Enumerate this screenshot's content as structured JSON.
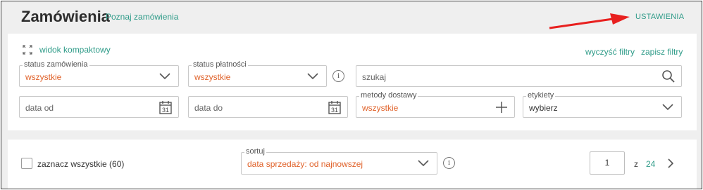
{
  "header": {
    "title": "Zamówienia",
    "learn_link": "Poznaj zamówienia",
    "settings_link": "USTAWIENIA"
  },
  "filters": {
    "compact_view": "widok kompaktowy",
    "clear_filters": "wyczyść filtry",
    "save_filters": "zapisz filtry",
    "order_status": {
      "label": "status zamówienia",
      "value": "wszystkie"
    },
    "payment_status": {
      "label": "status płatności",
      "value": "wszystkie"
    },
    "search": {
      "placeholder": "szukaj"
    },
    "date_from": {
      "placeholder": "data od"
    },
    "date_to": {
      "placeholder": "data do"
    },
    "delivery_methods": {
      "label": "metody dostawy",
      "value": "wszystkie"
    },
    "labels": {
      "label": "etykiety",
      "value": "wybierz"
    },
    "calendar_day": "31",
    "info_glyph": "i"
  },
  "list": {
    "select_all": "zaznacz wszystkie (60)",
    "sort": {
      "label": "sortuj",
      "value": "data sprzedaży: od najnowszej"
    },
    "pagination": {
      "current_page": "1",
      "of_label": "z",
      "total_pages": "24"
    }
  },
  "colors": {
    "accent": "#2e9b88",
    "value_orange": "#e0622a",
    "annotation_arrow": "#e8201f"
  },
  "icons": [
    "expand-icon",
    "chevron-down-icon",
    "info-icon",
    "search-icon",
    "calendar-icon",
    "plus-icon",
    "chevron-right-icon",
    "red-arrow-annotation"
  ]
}
